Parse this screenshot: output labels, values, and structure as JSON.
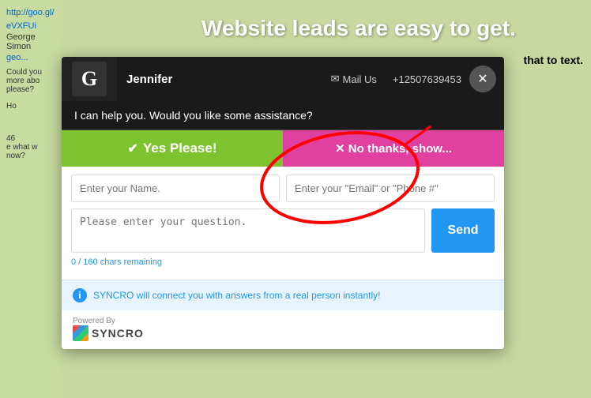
{
  "background": {
    "link1": "http://goo.gl/",
    "link2": "eVXFUi",
    "name": "George Simon",
    "email_link": "geo...",
    "could_you": "Could you",
    "more_about": "more abo",
    "please": "please?",
    "note1_line1": "46",
    "note1_line2": "e what w",
    "note1_line3": "now?",
    "side_text": "Ho"
  },
  "headline": "Website leads are easy to get.",
  "subtext": "that to text.",
  "chat": {
    "agent_name": "Jennifer",
    "mail_label": "✉ Mail Us",
    "phone": "+12507639453",
    "close_label": "✕",
    "message": "I can help you. Would you like some assistance?",
    "btn_yes_label": "Yes Please!",
    "btn_yes_check": "✔",
    "btn_yes_bold": "Yes",
    "btn_no_label": "✕ No thanks, show...",
    "name_placeholder": "Enter your Name.",
    "email_placeholder": "Enter your \"Email\" or \"Phone #\"",
    "question_placeholder": "Please enter your question.",
    "chars_remaining": "0 / 160 chars remaining",
    "send_label": "Send",
    "info_text": "SYNCRO will connect you with answers from a real person instantly!",
    "powered_by": "Powered By",
    "syncro_name": "SYNCRO"
  }
}
